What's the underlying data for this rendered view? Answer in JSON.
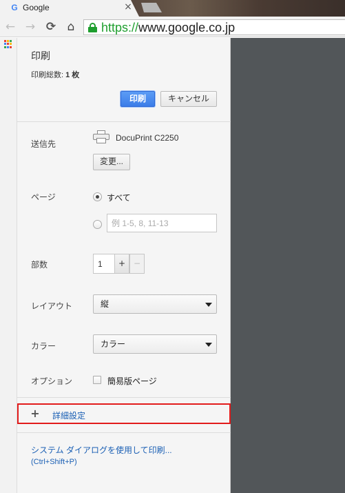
{
  "browser": {
    "tab": {
      "title": "Google",
      "favicon": "G",
      "close_glyph": "×"
    },
    "toolbar": {
      "back_icon": "←",
      "forward_icon": "→",
      "reload_icon": "⟳",
      "home_icon": "⌂",
      "url_scheme": "https://",
      "url_rest": "www.google.co.jp"
    }
  },
  "print": {
    "title": "印刷",
    "total_pages_label": "印刷総数: ",
    "total_pages_value": "1 枚",
    "print_button": "印刷",
    "cancel_button": "キャンセル",
    "destination": {
      "label": "送信先",
      "printer_name": "DocuPrint C2250",
      "change_button": "変更..."
    },
    "pages": {
      "label": "ページ",
      "all_label": "すべて",
      "all_selected": true,
      "custom_placeholder": "例 1-5, 8, 11-13"
    },
    "copies": {
      "label": "部数",
      "value": "1",
      "plus": "+",
      "minus": "−"
    },
    "layout": {
      "label": "レイアウト",
      "value": "縦"
    },
    "color": {
      "label": "カラー",
      "value": "カラー"
    },
    "options": {
      "label": "オプション",
      "simplify_label": "簡易版ページ",
      "simplify_checked": false
    },
    "advanced": {
      "icon": "+",
      "label": "詳細設定",
      "highlight_color": "#e21b1b"
    },
    "system_dialog": {
      "link": "システム ダイアログを使用して印刷...",
      "shortcut": "(Ctrl+Shift+P)"
    }
  },
  "colors": {
    "accent_blue": "#3b7de8",
    "link_blue": "#1a5fb4",
    "preview_bg": "#525659",
    "secure_green": "#1e9e2e"
  }
}
